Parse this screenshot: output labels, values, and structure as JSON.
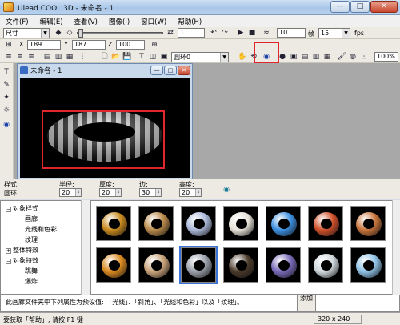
{
  "app": {
    "title": "Ulead COOL 3D - 未命名 - 1",
    "minimize": "—",
    "maximize": "□",
    "close": "✕"
  },
  "menu": [
    "文件(F)",
    "编辑(E)",
    "查看(V)",
    "图像(I)",
    "窗口(W)",
    "帮助(H)"
  ],
  "toolbar1": {
    "mode_select": "尺寸",
    "frame_value": "1",
    "frame_count_value": "10",
    "frames_label": "帧",
    "fps_value": "15",
    "fps_label": "fps"
  },
  "toolbar2": {
    "x_label": "X",
    "x_value": "189",
    "y_label": "Y",
    "y_value": "187",
    "z_label": "Z",
    "z_value": "100"
  },
  "toolbar3": {
    "object_select": "圆环0",
    "zoom_value": "100%"
  },
  "document": {
    "title": "未命名 - 1"
  },
  "params": {
    "style_label": "样式:",
    "style_value": "圆环",
    "radius_label": "半径:",
    "radius_value": "20",
    "thickness_label": "厚度:",
    "thickness_value": "20",
    "sides_label": "边:",
    "sides_value": "30",
    "height_label": "高度:",
    "height_value": "20"
  },
  "tree": {
    "items": [
      {
        "label": "对象样式",
        "toggle": "−",
        "level": 0
      },
      {
        "label": "画廊",
        "level": 1
      },
      {
        "label": "光线和色彩",
        "level": 1
      },
      {
        "label": "纹理",
        "level": 1
      },
      {
        "label": "整体特效",
        "toggle": "+",
        "level": 0
      },
      {
        "label": "对象特效",
        "toggle": "−",
        "level": 0
      },
      {
        "label": "跳舞",
        "level": 1
      },
      {
        "label": "爆炸",
        "level": 1
      }
    ]
  },
  "thumbnails": [
    {
      "name": "gold-ring",
      "color": "#c98a1e"
    },
    {
      "name": "brass-ring",
      "color": "#b88a4a"
    },
    {
      "name": "silver-blue-ring",
      "color": "#aab7d8"
    },
    {
      "name": "pale-ring",
      "color": "#e6e2d8"
    },
    {
      "name": "blue-crystal-ring",
      "color": "#3d8fe0"
    },
    {
      "name": "red-orange-ring",
      "color": "#d0502a"
    },
    {
      "name": "copper-ring",
      "color": "#c8743a"
    },
    {
      "name": "amber-ring",
      "color": "#d9891f"
    },
    {
      "name": "marble-ring",
      "color": "#c9a37a"
    },
    {
      "name": "striped-ring",
      "color": "#9aa0aa"
    },
    {
      "name": "dotted-ring",
      "color": "#4a3a2a"
    },
    {
      "name": "glass-ring",
      "color": "#7a6ab8"
    },
    {
      "name": "white-ring",
      "color": "#d0d8dc"
    },
    {
      "name": "chrome-ring",
      "color": "#8fc2e6"
    }
  ],
  "info": {
    "text": "此画廊文件夹中下列属性为预设值: 「光线」、「斜角」、「光线和色彩」以及「纹理」。",
    "apply_label": "添加"
  },
  "status": {
    "text": "要获取「帮助」, 请按 F1 键",
    "size": "320 x 240"
  },
  "colors": {
    "highlight_box": "#e0262c",
    "selected_thumb": "#3b72d8"
  }
}
